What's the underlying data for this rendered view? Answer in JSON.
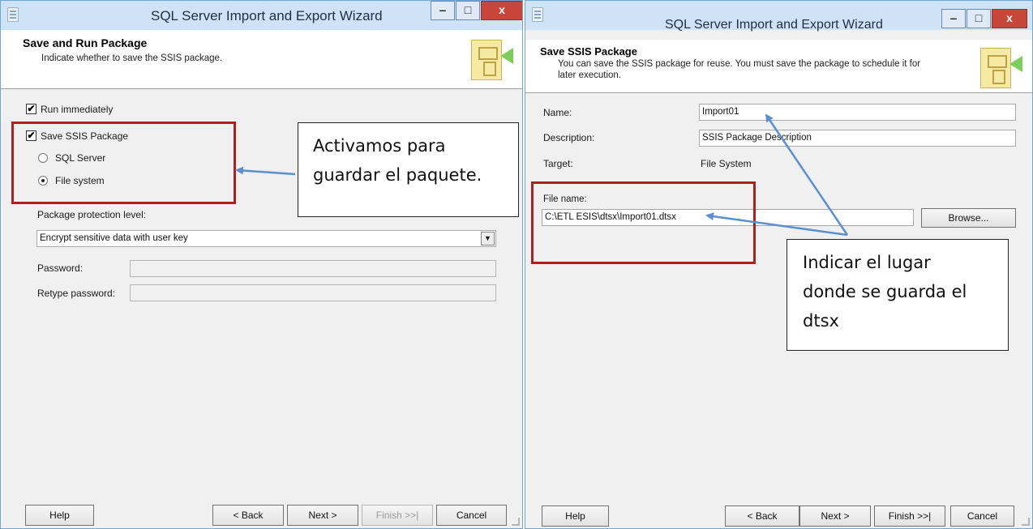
{
  "left": {
    "title": "SQL Server Import and Export Wizard",
    "window_buttons": {
      "minimize": "‒",
      "maximize": "□",
      "close": "x"
    },
    "header": {
      "title": "Save and Run Package",
      "description": "Indicate whether to save the SSIS package."
    },
    "run_immediately": {
      "label": "Run immediately",
      "checked": "✔"
    },
    "save_ssis": {
      "label": "Save SSIS Package",
      "checked": "✔"
    },
    "sql_server_label": "SQL Server",
    "file_system_label": "File system",
    "protection_label": "Package protection level:",
    "protection_value": "Encrypt sensitive data with user key",
    "combo_arrow": "▼",
    "password_label": "Password:",
    "retype_label": "Retype password:",
    "callout_lines": [
      "Activamos para",
      "guardar el paquete."
    ],
    "buttons": {
      "help": "Help",
      "back": "< Back",
      "next": "Next >",
      "finish": "Finish >>|",
      "cancel": "Cancel"
    }
  },
  "right": {
    "title": "SQL Server Import and Export Wizard",
    "window_buttons": {
      "minimize": "‒",
      "maximize": "□",
      "close": "x"
    },
    "header": {
      "title": "Save SSIS Package",
      "description_line1": "You can save the SSIS package for reuse. You must save the package to schedule it for",
      "description_line2": "later execution."
    },
    "name_label": "Name:",
    "name_value": "Import01",
    "description_label": "Description:",
    "description_value": "SSIS Package Description",
    "target_label": "Target:",
    "target_value": "File System",
    "file_name_label": "File name:",
    "file_name_value": "C:\\ETL ESIS\\dtsx\\Import01.dtsx",
    "browse_label": "Browse...",
    "callout_lines": [
      "Indicar el lugar",
      "donde se guarda el",
      "dtsx"
    ],
    "buttons": {
      "help": "Help",
      "back": "< Back",
      "next": "Next >",
      "finish": "Finish >>|",
      "cancel": "Cancel"
    }
  },
  "colors": {
    "annotation_box": "#b11e1e",
    "annotation_arrow": "#5b8fcf",
    "titlebar": "#cfe3f6",
    "close_button": "#c8453a"
  }
}
